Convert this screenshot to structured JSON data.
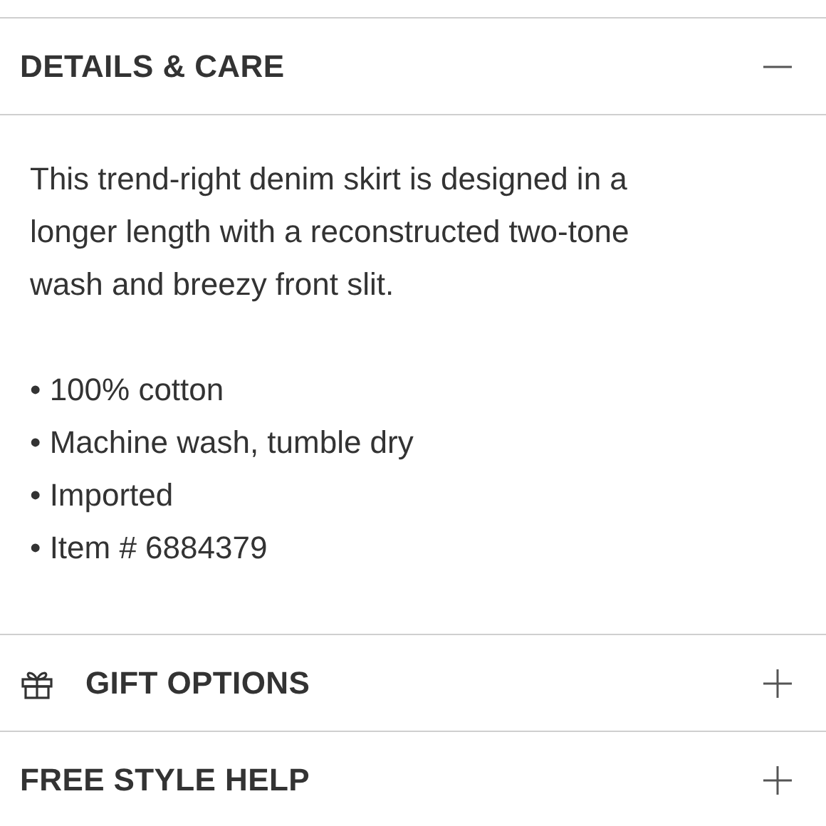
{
  "sections": [
    {
      "title": "DETAILS & CARE",
      "kind": "plain",
      "expanded": true,
      "description": "This trend-right denim skirt is designed in a longer length with a reconstructed two-tone wash and breezy front slit.",
      "bullets": [
        "• 100% cotton",
        "• Machine wash, tumble dry",
        "• Imported",
        "• Item # 6884379"
      ]
    },
    {
      "title": "GIFT OPTIONS",
      "kind": "with-icon",
      "expanded": false
    },
    {
      "title": "FREE STYLE HELP",
      "kind": "plain",
      "expanded": false
    }
  ]
}
